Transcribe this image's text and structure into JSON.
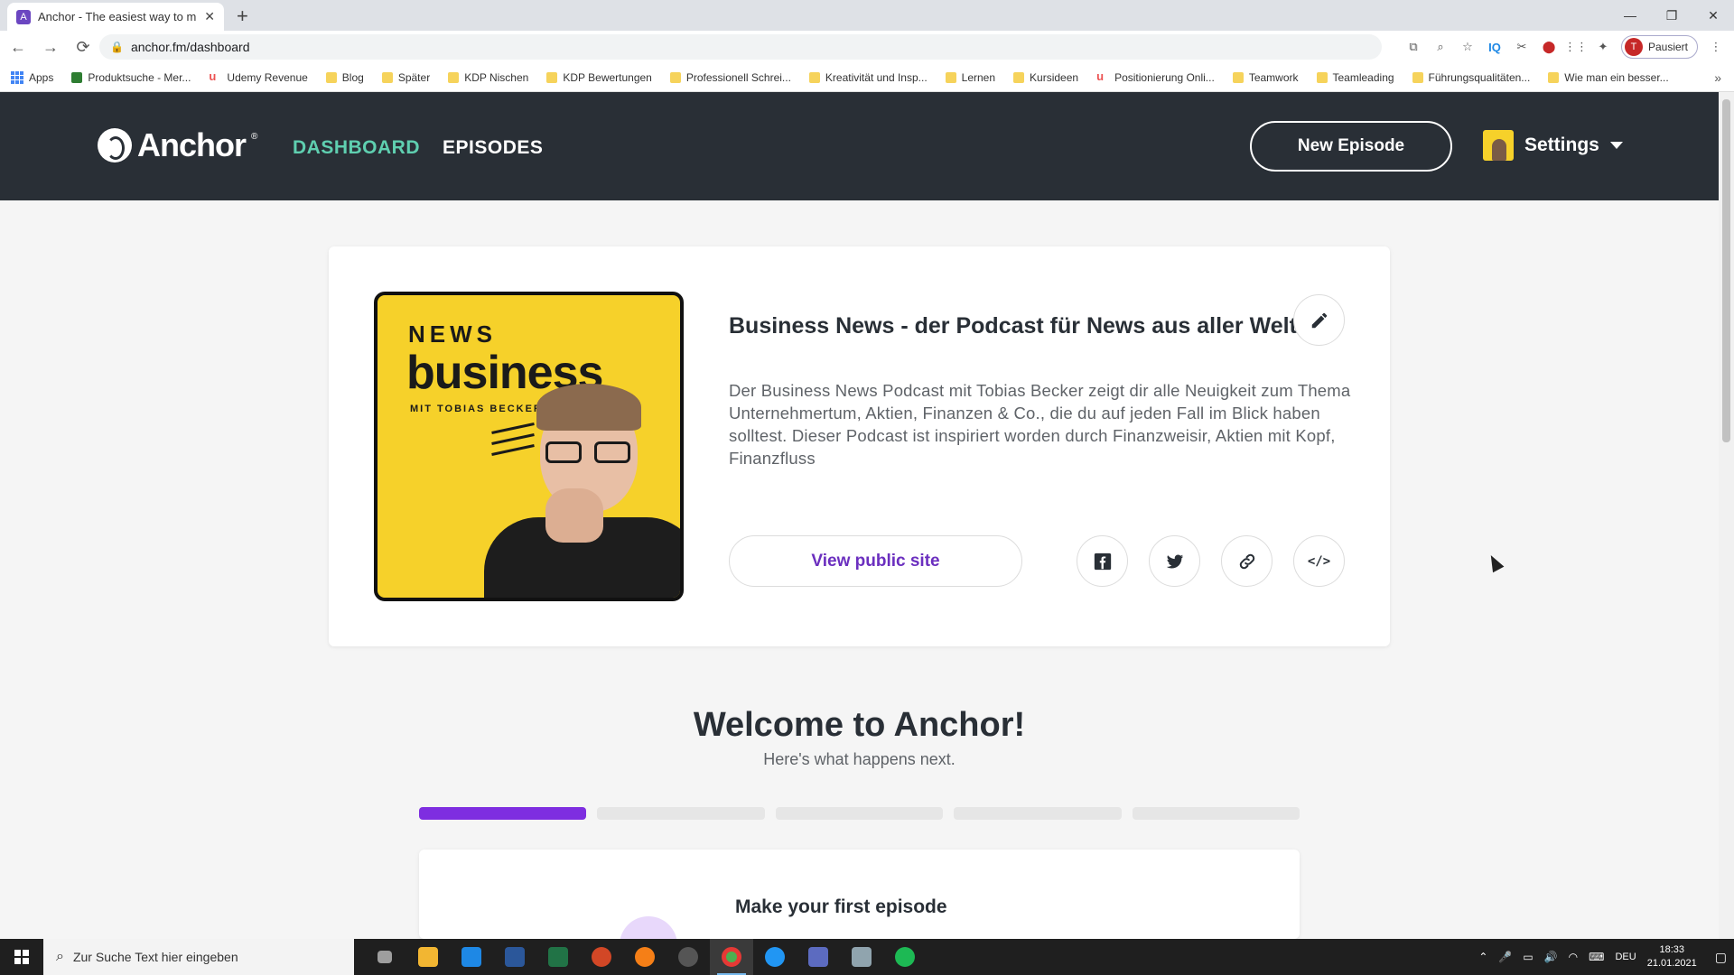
{
  "browser": {
    "tab_title": "Anchor - The easiest way to mak",
    "favicon_glyph": "A",
    "close_glyph": "✕",
    "new_tab_glyph": "+",
    "url": "anchor.fm/dashboard",
    "lock_glyph": "🔒",
    "back_glyph": "←",
    "forward_glyph": "→",
    "reload_glyph": "⟳",
    "minimize_glyph": "—",
    "restore_glyph": "❐",
    "window_close_glyph": "✕",
    "profile_initial": "T",
    "profile_label": "Pausiert",
    "ext_glyphs": [
      "⧉",
      "⌕",
      "☆",
      "IQ",
      "✂",
      "⬤",
      "⋮⋮",
      "✦"
    ],
    "menu_glyph": "⋮"
  },
  "bookmarks": [
    {
      "label": "Apps",
      "icon": "apps"
    },
    {
      "label": "Produktsuche - Mer...",
      "icon": "green"
    },
    {
      "label": "Udemy Revenue",
      "icon": "udemy"
    },
    {
      "label": "Blog",
      "icon": "folder"
    },
    {
      "label": "Später",
      "icon": "folder"
    },
    {
      "label": "KDP Nischen",
      "icon": "folder"
    },
    {
      "label": "KDP Bewertungen",
      "icon": "folder"
    },
    {
      "label": "Professionell Schrei...",
      "icon": "folder"
    },
    {
      "label": "Kreativität und Insp...",
      "icon": "folder"
    },
    {
      "label": "Lernen",
      "icon": "folder"
    },
    {
      "label": "Kursideen",
      "icon": "folder"
    },
    {
      "label": "Positionierung Onli...",
      "icon": "udemy"
    },
    {
      "label": "Teamwork",
      "icon": "folder"
    },
    {
      "label": "Teamleading",
      "icon": "folder"
    },
    {
      "label": "Führungsqualitäten...",
      "icon": "folder"
    },
    {
      "label": "Wie man ein besser...",
      "icon": "folder"
    }
  ],
  "bookmarks_more": "»",
  "header": {
    "logo_text": "Anchor",
    "logo_reg": "®",
    "nav_dashboard": "DASHBOARD",
    "nav_episodes": "EPISODES",
    "new_episode": "New Episode",
    "settings": "Settings"
  },
  "podcast": {
    "cover_news": "NEWS",
    "cover_business": "business",
    "cover_mit": "MIT TOBIAS BECKER",
    "title": "Business News - der Podcast für News aus aller Welt",
    "description": "Der Business News Podcast mit Tobias Becker zeigt dir alle Neuigkeit zum Thema Unternehmertum, Aktien, Finanzen & Co., die du auf jeden Fall im Blick haben solltest. Dieser Podcast ist inspiriert worden durch Finanzweisir, Aktien mit Kopf, Finanzfluss",
    "view_site": "View public site",
    "embed_glyph": "</>"
  },
  "welcome": {
    "title": "Welcome to Anchor!",
    "subtitle": "Here's what happens next.",
    "progress_total_steps": 5,
    "progress_completed_steps": 1,
    "step_title": "Make your first episode"
  },
  "taskbar": {
    "search_placeholder": "Zur Suche Text hier eingeben",
    "search_glyph": "⌕",
    "lang": "DEU",
    "time": "18:33",
    "date": "21.01.2021",
    "tray_glyphs": [
      "⌃",
      "🎤",
      "▭",
      "🔊",
      "◠",
      "⌨"
    ],
    "notif_glyph": "▢",
    "app_colors": [
      "#9e9e9e",
      "#f2b632",
      "#1e88e5",
      "#2b579a",
      "#217346",
      "#d24726",
      "#f57f17",
      "#555555",
      "#4caf50",
      "#2196f3",
      "#5c6bc0",
      "#90a4ae",
      "#1db954"
    ]
  },
  "colors": {
    "accent_purple": "#7e2ee0",
    "nav_active": "#5fcfb0",
    "header_bg": "#292f36",
    "link_purple": "#6b2fbf"
  }
}
